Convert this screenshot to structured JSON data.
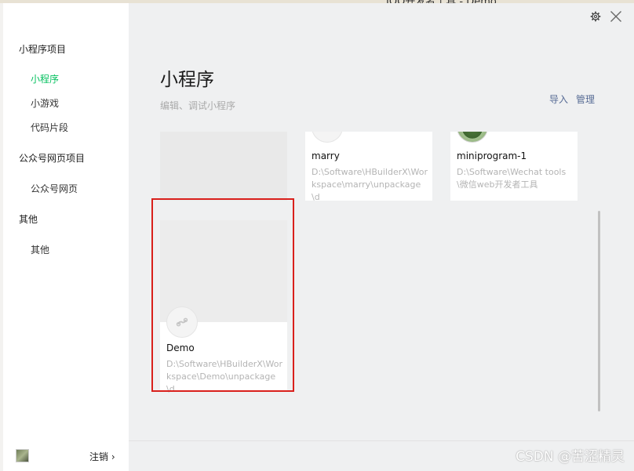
{
  "background": {
    "title_fragment": "JOO开发者工具 - Demo"
  },
  "sidebar": {
    "groups": [
      {
        "label": "小程序项目",
        "items": [
          "小程序",
          "小游戏",
          "代码片段"
        ]
      },
      {
        "label": "公众号网页项目",
        "items": [
          "公众号网页"
        ]
      },
      {
        "label": "其他",
        "items": [
          "其他"
        ]
      }
    ],
    "active_item": "小程序",
    "logout_label": "注销 ›"
  },
  "main": {
    "title": "小程序",
    "subtitle": "编辑、调试小程序",
    "actions": {
      "import": "导入",
      "manage": "管理"
    },
    "projects": [
      {
        "name": "marry",
        "path": "D:\\Software\\HBuilderX\\Workspace\\marry\\unpackage\\d"
      },
      {
        "name": "miniprogram-1",
        "path": "D:\\Software\\Wechat tools\\微信web开发者工具"
      },
      {
        "name": "Demo",
        "path": "D:\\Software\\HBuilderX\\Workspace\\Demo\\unpackage\\d"
      }
    ]
  },
  "watermark": "CSDN @苦涩精灵",
  "colors": {
    "accent_green": "#07c160",
    "link_blue": "#576b95",
    "highlight_red": "#d9201c"
  },
  "icons": {
    "settings": "gear-icon",
    "close": "close-icon",
    "miniprogram": "miniprogram-logo-icon"
  }
}
